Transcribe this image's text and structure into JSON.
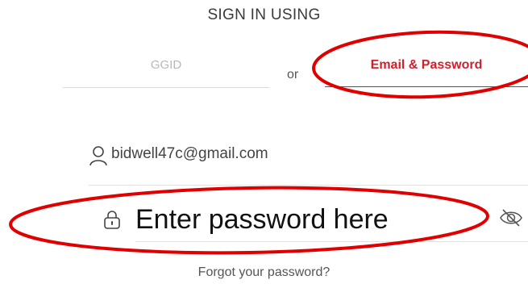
{
  "heading": "SIGN IN USING",
  "tabs": [
    {
      "label": "GGID",
      "active": false
    },
    {
      "label": "Email & Password",
      "active": true
    }
  ],
  "separator": "or",
  "email_field": {
    "value": "bidwell47c@gmail.com",
    "icon": "user-icon"
  },
  "password_field": {
    "placeholder": "Enter password here",
    "icon": "lock-icon",
    "toggle_icon": "eye-slash-icon"
  },
  "forgot_link": "Forgot your password?",
  "colors": {
    "accent": "#d0202b",
    "annotation": "#e00000",
    "muted": "#b8b8b8"
  }
}
